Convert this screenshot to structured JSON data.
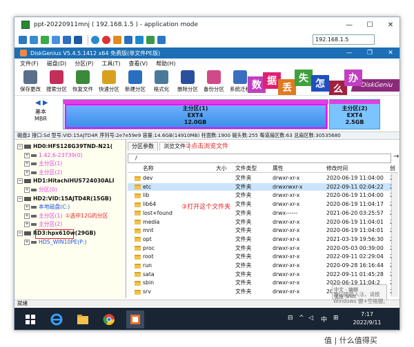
{
  "remote_window": {
    "title": "ppt-20220911mnj ( 192.168.1.5 ) - application mode",
    "ip_field": "192.168.1.5",
    "controls": {
      "minimize": "—",
      "maximize": "☐",
      "close": "✕"
    }
  },
  "dg_window": {
    "title": "DiskGenius V5.4.5.1412 x64 免费版(单文件PE版)",
    "controls": {
      "minimize": "—",
      "restore": "❐",
      "close": "✕"
    }
  },
  "menu": [
    "文件(F)",
    "磁盘(D)",
    "分区(P)",
    "工具(T)",
    "查看(V)",
    "帮助(H)"
  ],
  "toolbar": [
    {
      "label": "保存更改",
      "color": "#5a6f8a"
    },
    {
      "label": "搜索分区",
      "color": "#c2305a"
    },
    {
      "label": "恢复文件",
      "color": "#3a8a3a"
    },
    {
      "label": "快速分区",
      "color": "#d9a020"
    },
    {
      "label": "新建分区",
      "color": "#2a6fbf"
    },
    {
      "label": "格式化",
      "color": "#4a7a9a"
    },
    {
      "label": "删除分区",
      "color": "#2a4f9f"
    },
    {
      "label": "备份分区",
      "color": "#d04a8a"
    },
    {
      "label": "系统迁移",
      "color": "#3a6fbf"
    }
  ],
  "banner": {
    "chars": [
      {
        "t": "数",
        "c": "#c040c0"
      },
      {
        "t": "据",
        "c": "#e02070"
      },
      {
        "t": "丢",
        "c": "#e07a20"
      },
      {
        "t": "失",
        "c": "#40a040"
      },
      {
        "t": "怎",
        "c": "#2050c0"
      },
      {
        "t": "么",
        "c": "#a02040"
      },
      {
        "t": "办",
        "c": "#c040c0"
      }
    ],
    "brand": "DiskGeniu"
  },
  "diskmap": {
    "disk_label": "基本",
    "disk_type": "MBR",
    "partitions": [
      {
        "name": "主分区(1)",
        "fs": "EXT4",
        "size": "12.0GB"
      },
      {
        "name": "主分区(2)",
        "fs": "EXT4",
        "size": "2.5GB"
      }
    ]
  },
  "infobar": "磁盘2 接口:Sd  型号:VID:15AJTD4R  序列号:2e7e59e9  容量:14.6GB(14910MB)  柱面数:1900  磁头数:255  每道扇区数:63  总扇区数:30535680",
  "tree": [
    {
      "indent": 4,
      "kind": "disk",
      "text": "HD0:HFS128G39TND-N21(",
      "cls": ""
    },
    {
      "indent": 14,
      "kind": "part",
      "text": "1.42.6-23739(0)",
      "cls": "pink"
    },
    {
      "indent": 14,
      "kind": "part",
      "text": "主分区(1)",
      "cls": "pink"
    },
    {
      "indent": 14,
      "kind": "part",
      "text": "主分区(2)",
      "cls": "pink"
    },
    {
      "indent": 4,
      "kind": "disk",
      "text": "HD1:HitachiHUS724030ALI",
      "cls": ""
    },
    {
      "indent": 14,
      "kind": "part",
      "text": "分区(0)",
      "cls": "pink"
    },
    {
      "indent": 4,
      "kind": "disk",
      "text": "HD2:VID:15AJTD4R(15GB)",
      "cls": ""
    },
    {
      "indent": 14,
      "kind": "part",
      "text": "本地磁盘(C:)",
      "cls": "blue"
    },
    {
      "indent": 14,
      "kind": "part",
      "text": "主分区(1)",
      "cls": "pink",
      "annot": "①选中12G的分区"
    },
    {
      "indent": 14,
      "kind": "part",
      "text": "主分区(2)",
      "cls": "pink"
    },
    {
      "indent": 4,
      "kind": "disk",
      "text": "RD3:hpx610w(29GB)",
      "cls": ""
    },
    {
      "indent": 14,
      "kind": "part",
      "text": "HDS_WIN10PE(P:)",
      "cls": "blue"
    }
  ],
  "tabs": [
    "分区参数",
    "浏览文件"
  ],
  "tab_annot": "②点击浏览文件",
  "path": "/",
  "columns": [
    "名称",
    "大小",
    "文件类型",
    "属性",
    "修改时间",
    "创"
  ],
  "files": [
    {
      "name": "dev",
      "type": "文件夹",
      "attr": "drwxr-xr-x",
      "time": "2020-06-19 11:04:00",
      "c": "2"
    },
    {
      "name": "etc",
      "type": "文件夹",
      "attr": "drwxrwxr-x",
      "time": "2022-09-11 02:04:22",
      "c": "2"
    },
    {
      "name": "lib",
      "type": "文件夹",
      "attr": "drwxr-xr-x",
      "time": "2020-06-19 11:04:00",
      "c": "2"
    },
    {
      "name": "lib64",
      "type": "文件夹",
      "attr": "drwxr-xr-x",
      "time": "2020-06-19 11:04:17",
      "c": "2"
    },
    {
      "name": "lost+found",
      "type": "文件夹",
      "attr": "drwx------",
      "time": "2021-06-20 03:25:57",
      "c": "2"
    },
    {
      "name": "media",
      "type": "文件夹",
      "attr": "drwxr-xr-x",
      "time": "2020-06-19 11:04:01",
      "c": "2"
    },
    {
      "name": "mnt",
      "type": "文件夹",
      "attr": "drwxr-xr-x",
      "time": "2020-06-19 11:04:01",
      "c": "2"
    },
    {
      "name": "opt",
      "type": "文件夹",
      "attr": "drwxr-xr-x",
      "time": "2021-03-19 19:56:30",
      "c": "2"
    },
    {
      "name": "proc",
      "type": "文件夹",
      "attr": "drwxr-xr-x",
      "time": "2020-05-03 00:39:00",
      "c": "2"
    },
    {
      "name": "root",
      "type": "文件夹",
      "attr": "drwxr-xr-x",
      "time": "2022-09-11 02:29:04",
      "c": "2"
    },
    {
      "name": "run",
      "type": "文件夹",
      "attr": "drwxr-xr-x",
      "time": "2020-09-28 16:16:44",
      "c": "2"
    },
    {
      "name": "sata",
      "type": "文件夹",
      "attr": "drwxr-xr-x",
      "time": "2022-09-11 01:45:28",
      "c": "2"
    },
    {
      "name": "sbin",
      "type": "文件夹",
      "attr": "drwxr-xr-x",
      "time": "2020-06-19 11:04:2",
      "c": "2"
    },
    {
      "name": "srv",
      "type": "文件夹",
      "attr": "drwxr-xr-x",
      "time": "2020-06-19 11:04:0",
      "c": "2"
    }
  ],
  "row_annot": "③打开这个文件夹",
  "ime_popup": [
    "中文 - 编辑",
    "请按 Shift"
  ],
  "activation": [
    "要切换输入法，请按",
    "Windows 键+空格键。"
  ],
  "status": "就绪",
  "clock": {
    "time": "7:17",
    "date": "2022/9/11"
  },
  "tray": [
    "中",
    "⊞"
  ],
  "watermark": "值 | 什么值得买"
}
